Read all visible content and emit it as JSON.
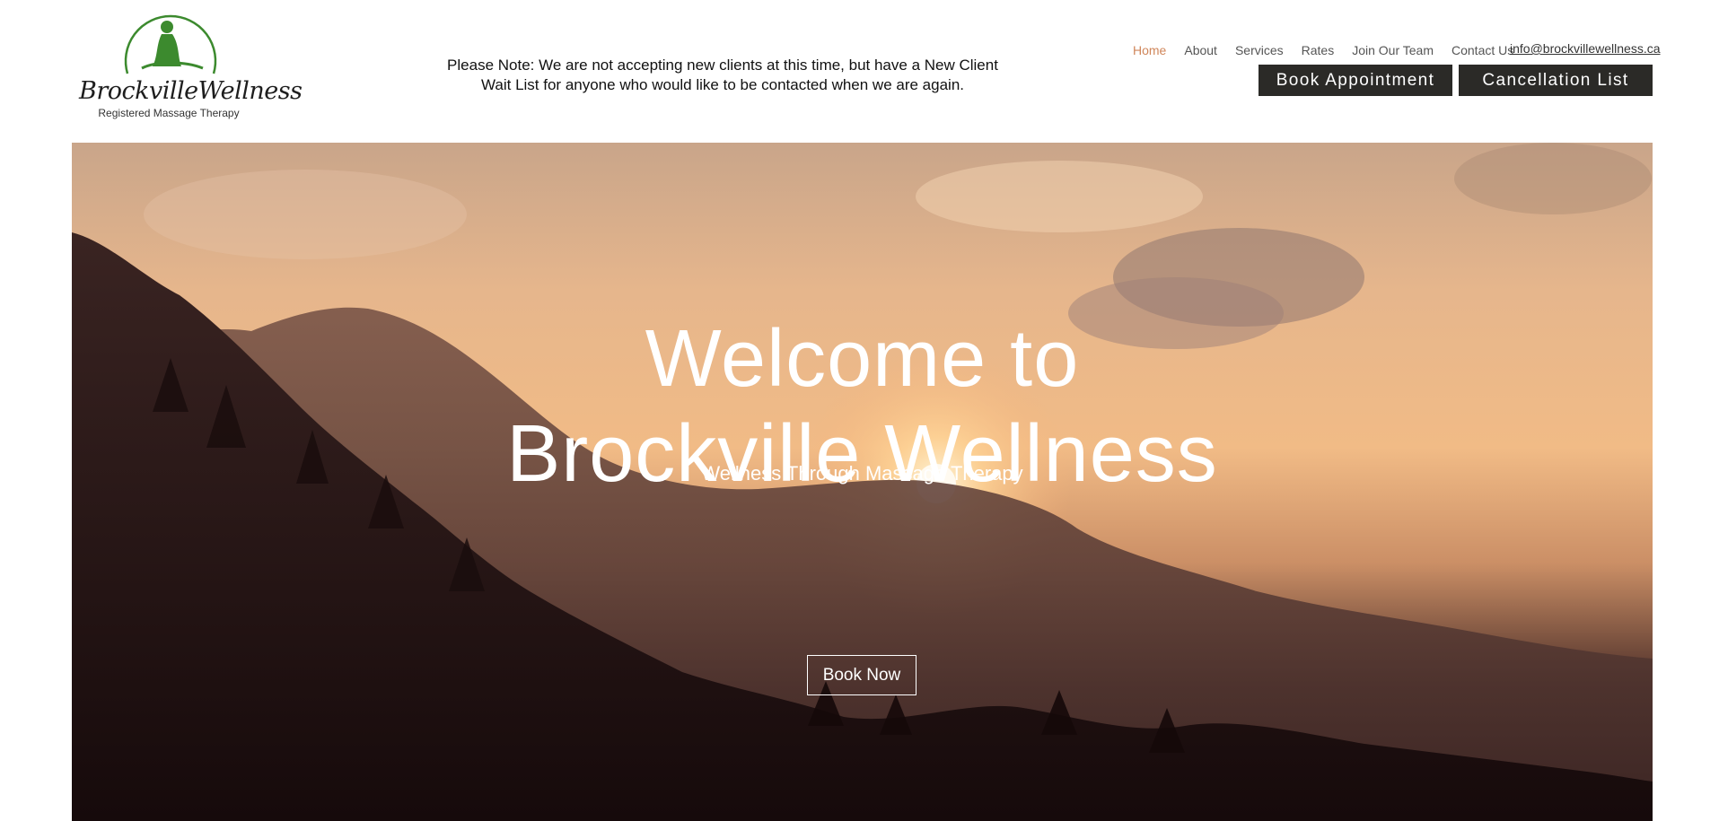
{
  "brand": {
    "name": "BrockvilleWellness",
    "tagline": "Registered Massage Therapy",
    "logo_icon": "massage-figure-icon",
    "logo_color": "#3c8a2e"
  },
  "notice": {
    "line1": "Please Note: We are not accepting new clients at this time, but have a New Client",
    "line2": "Wait List for anyone who would like to be contacted when we are again."
  },
  "nav": {
    "items": [
      "Home",
      "About",
      "Services",
      "Rates",
      "Join Our Team",
      "Contact Us"
    ],
    "active": "Home",
    "active_color": "#d0865a"
  },
  "contact": {
    "email": "info@brockvillewellness.ca"
  },
  "buttons": {
    "book_appointment": "Book Appointment",
    "cancellation_list": "Cancellation List",
    "button_color": "#2b2a27"
  },
  "hero": {
    "title_line1": "Welcome to",
    "title_line2": "Brockville Wellness",
    "subtitle": "Wellness Through Massage Therapy",
    "cta": "Book Now",
    "background": "sunset-mountains-image"
  }
}
